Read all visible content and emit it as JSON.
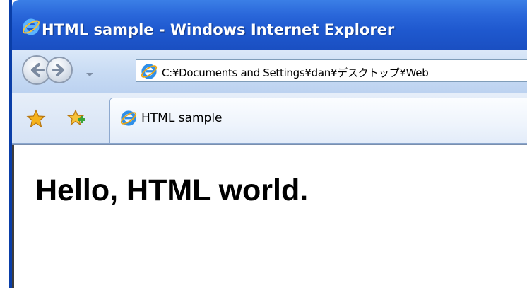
{
  "window": {
    "title": "HTML sample - Windows Internet Explorer",
    "app_icon": "internet-explorer-icon"
  },
  "navigation": {
    "back_icon": "back-arrow-icon",
    "forward_icon": "forward-arrow-icon",
    "dropdown_icon": "chevron-down-icon",
    "address": "C:¥Documents and Settings¥dan¥デスクトップ¥Web"
  },
  "tabs": {
    "favorites_icon": "star-icon",
    "add_favorites_icon": "add-favorite-icon",
    "items": [
      {
        "label": "HTML sample",
        "icon": "internet-explorer-icon"
      }
    ]
  },
  "page": {
    "heading": "Hello, HTML world."
  },
  "colors": {
    "titlebar": "#2a67da",
    "toolbar": "#c9dcf4",
    "address_border": "#7f9db9"
  }
}
